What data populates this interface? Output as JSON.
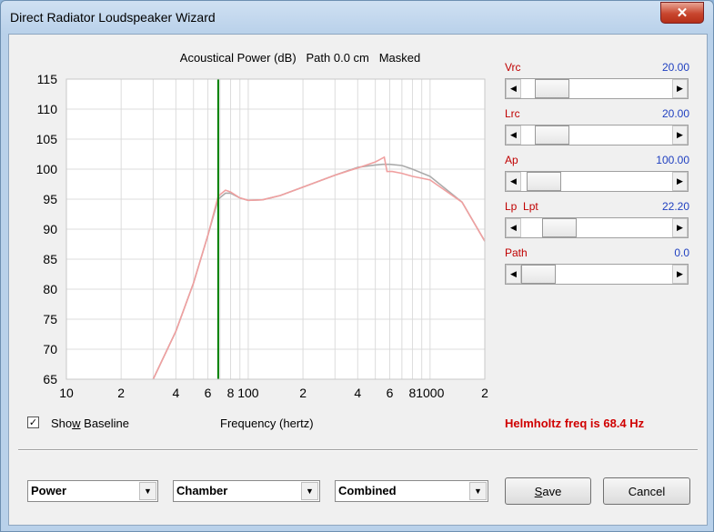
{
  "window": {
    "title": "Direct Radiator Loudspeaker Wizard",
    "close_glyph": "✕"
  },
  "chart": {
    "header": "Acoustical Power (dB)   Path 0.0 cm   Masked",
    "x_axis_label": "Frequency (hertz)",
    "marker_color": "#008000"
  },
  "chart_data": {
    "type": "line",
    "title": "Acoustical Power (dB)   Path 0.0 cm   Masked",
    "xlabel": "Frequency (hertz)",
    "ylabel": "",
    "x_scale": "log",
    "xlim": [
      10,
      2000
    ],
    "ylim": [
      65,
      115
    ],
    "y_ticks": [
      115,
      110,
      105,
      100,
      95,
      90,
      85,
      80,
      75,
      70,
      65
    ],
    "x_tick_labels": [
      "10",
      "2",
      "4",
      "6",
      "8",
      "100",
      "2",
      "4",
      "6",
      "8",
      "1000",
      "2"
    ],
    "x_tick_values": [
      10,
      20,
      40,
      60,
      80,
      100,
      200,
      400,
      600,
      800,
      1000,
      2000
    ],
    "grid": true,
    "marker_line": {
      "x": 68.4,
      "color": "#008000"
    },
    "series": [
      {
        "color": "#aaaaaa",
        "x": [
          30,
          40,
          50,
          60,
          68.4,
          75,
          80,
          90,
          100,
          120,
          150,
          200,
          300,
          400,
          500,
          550,
          600,
          700,
          800,
          1000,
          1500,
          2000
        ],
        "y": [
          65,
          73,
          81,
          89,
          95,
          96,
          96,
          95.2,
          94.8,
          94.9,
          95.6,
          97,
          99,
          100.3,
          100.7,
          100.8,
          100.8,
          100.6,
          100,
          98.8,
          94.5,
          88
        ]
      },
      {
        "color": "#f0a0a0",
        "x": [
          30,
          40,
          50,
          60,
          68.4,
          75,
          80,
          90,
          100,
          120,
          150,
          200,
          300,
          400,
          500,
          530,
          560,
          580,
          620,
          700,
          800,
          1000,
          1500,
          2000
        ],
        "y": [
          65,
          73,
          81,
          89,
          95.5,
          96.5,
          96.2,
          95.2,
          94.8,
          94.9,
          95.6,
          97,
          99,
          100.2,
          101.2,
          101.6,
          102,
          99.6,
          99.6,
          99.3,
          98.8,
          98.2,
          94.5,
          88
        ]
      }
    ]
  },
  "sliders": [
    {
      "label": "Vrc",
      "value": "20.00",
      "position": 0.12
    },
    {
      "label": "Lrc",
      "value": "20.00",
      "position": 0.12
    },
    {
      "label": "Ap",
      "value": "100.00",
      "position": 0.05
    },
    {
      "label": "Lp  Lpt",
      "value": "22.20",
      "position": 0.18
    },
    {
      "label": "Path",
      "value": "0.0",
      "position": 0.0
    }
  ],
  "baseline": {
    "checked_glyph": "✓",
    "label_pre": "Sho",
    "label_key": "w",
    "label_post": " Baseline"
  },
  "helmholtz_text": "Helmholtz freq is 68.4 Hz",
  "dropdowns": [
    {
      "value": "Power"
    },
    {
      "value": "Chamber"
    },
    {
      "value": "Combined"
    }
  ],
  "buttons": {
    "save_key": "S",
    "save_rest": "ave",
    "cancel": "Cancel"
  },
  "glyphs": {
    "left_arrow": "◀",
    "right_arrow": "▶",
    "down_arrow": "▼"
  }
}
